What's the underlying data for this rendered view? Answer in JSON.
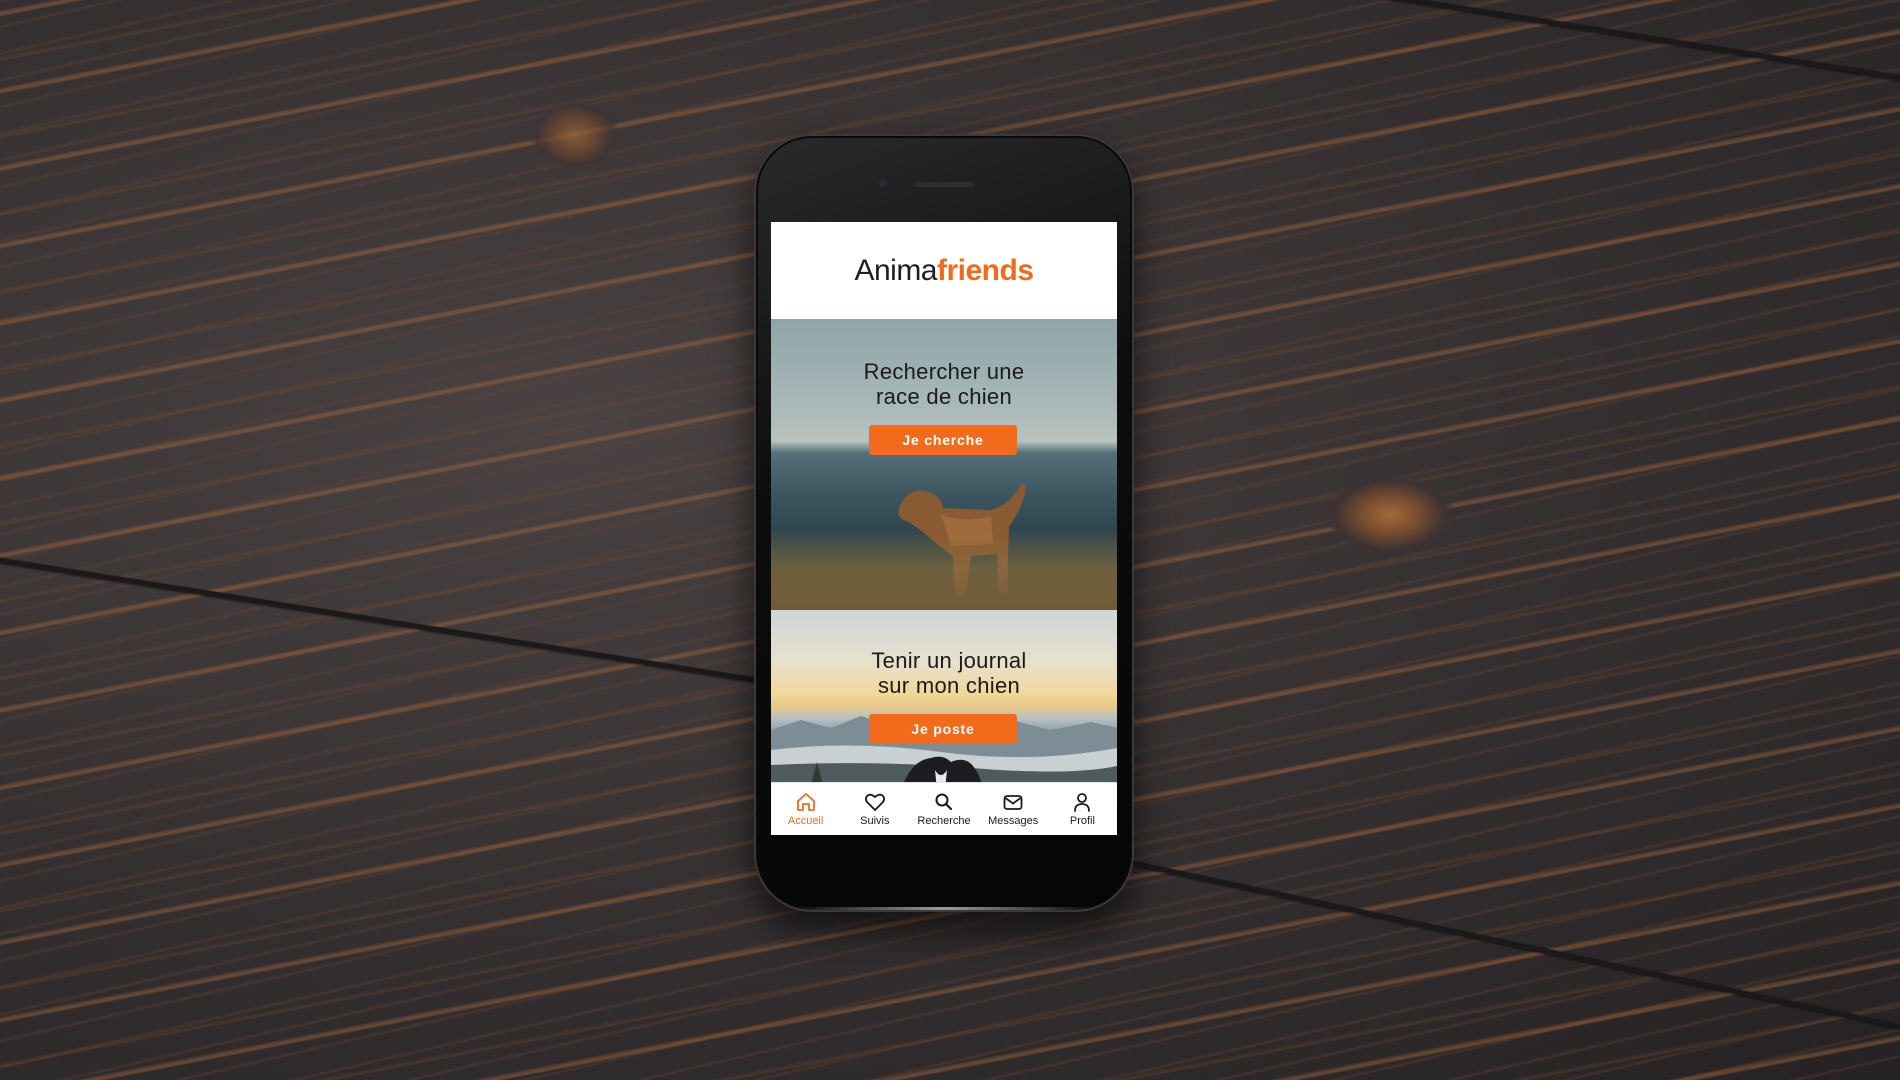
{
  "app": {
    "logo_part1": "Anima",
    "logo_part2": "friends"
  },
  "cards": [
    {
      "title_line1": "Rechercher une",
      "title_line2": "race de chien",
      "button_label": "Je cherche"
    },
    {
      "title_line1": "Tenir un journal",
      "title_line2": "sur mon chien",
      "button_label": "Je poste"
    }
  ],
  "nav": {
    "items": [
      {
        "label": "Accueil",
        "icon": "home-icon",
        "active": true
      },
      {
        "label": "Suivis",
        "icon": "heart-icon",
        "active": false
      },
      {
        "label": "Recherche",
        "icon": "search-icon",
        "active": false
      },
      {
        "label": "Messages",
        "icon": "mail-icon",
        "active": false
      },
      {
        "label": "Profil",
        "icon": "user-icon",
        "active": false
      }
    ]
  },
  "colors": {
    "accent": "#f26b1d",
    "text": "#1a1a1a",
    "screen_bg": "#ffffff"
  }
}
